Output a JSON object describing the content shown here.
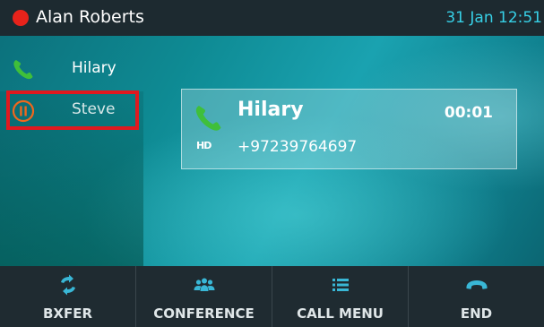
{
  "status_bar": {
    "user_name": "Alan Roberts",
    "presence_color": "#e8231b",
    "datetime": "31 Jan 12:51"
  },
  "call_list": {
    "items": [
      {
        "label": "Hilary",
        "state": "active",
        "icon": "phone-icon",
        "icon_color": "#3fbf3a"
      },
      {
        "label": "Steve",
        "state": "held",
        "icon": "pause-icon",
        "icon_color": "#f0671c"
      }
    ],
    "highlight_color": "#e0191f"
  },
  "active_call": {
    "name": "Hilary",
    "number": "+97239764697",
    "timer": "00:01",
    "hd_badge": "HD",
    "icon": "phone-icon"
  },
  "softkeys": [
    {
      "label": "BXFER",
      "icon": "transfer-arrows-icon"
    },
    {
      "label": "CONFERENCE",
      "icon": "conference-people-icon"
    },
    {
      "label": "CALL MENU",
      "icon": "menu-list-icon"
    },
    {
      "label": "END",
      "icon": "hang-up-icon"
    }
  ],
  "colors": {
    "accent": "#37d0e6",
    "softkey_icon": "#39b7d6"
  }
}
